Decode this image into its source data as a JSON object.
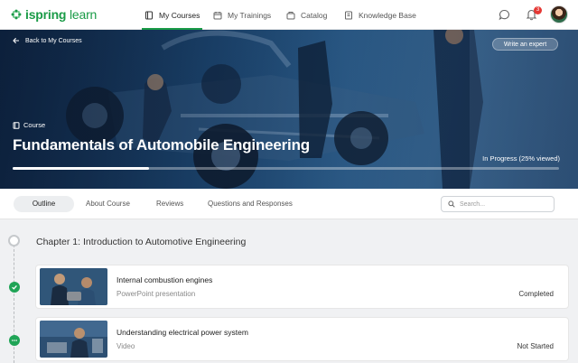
{
  "app": {
    "logo_brand": "ispring",
    "logo_product": "learn",
    "brand_color": "#1a9b47"
  },
  "nav": {
    "items": [
      {
        "label": "My Courses",
        "icon": "book-icon",
        "active": true
      },
      {
        "label": "My Trainings",
        "icon": "calendar-icon",
        "active": false
      },
      {
        "label": "Catalog",
        "icon": "catalog-icon",
        "active": false
      },
      {
        "label": "Knowledge Base",
        "icon": "knowledge-base-icon",
        "active": false
      }
    ],
    "notification_count": "3"
  },
  "hero": {
    "back_label": "Back to My Courses",
    "write_expert_label": "Write an expert",
    "type_label": "Course",
    "title": "Fundamentals of Automobile Engineering",
    "progress_text": "In Progress (25% viewed)",
    "progress_fraction": 0.25
  },
  "tabs": {
    "items": [
      "Outline",
      "About Course",
      "Reviews",
      "Questions and Responses"
    ],
    "active": "Outline",
    "search_placeholder": "Search..."
  },
  "outline": {
    "chapter_title": "Chapter 1: Introduction to Automotive Engineering",
    "items": [
      {
        "title": "Internal combustion engines",
        "type": "PowerPoint presentation",
        "status": "Completed",
        "state": "completed"
      },
      {
        "title": "Understanding electrical power system",
        "type": "Video",
        "status": "Not Started",
        "state": "not-started"
      }
    ]
  }
}
